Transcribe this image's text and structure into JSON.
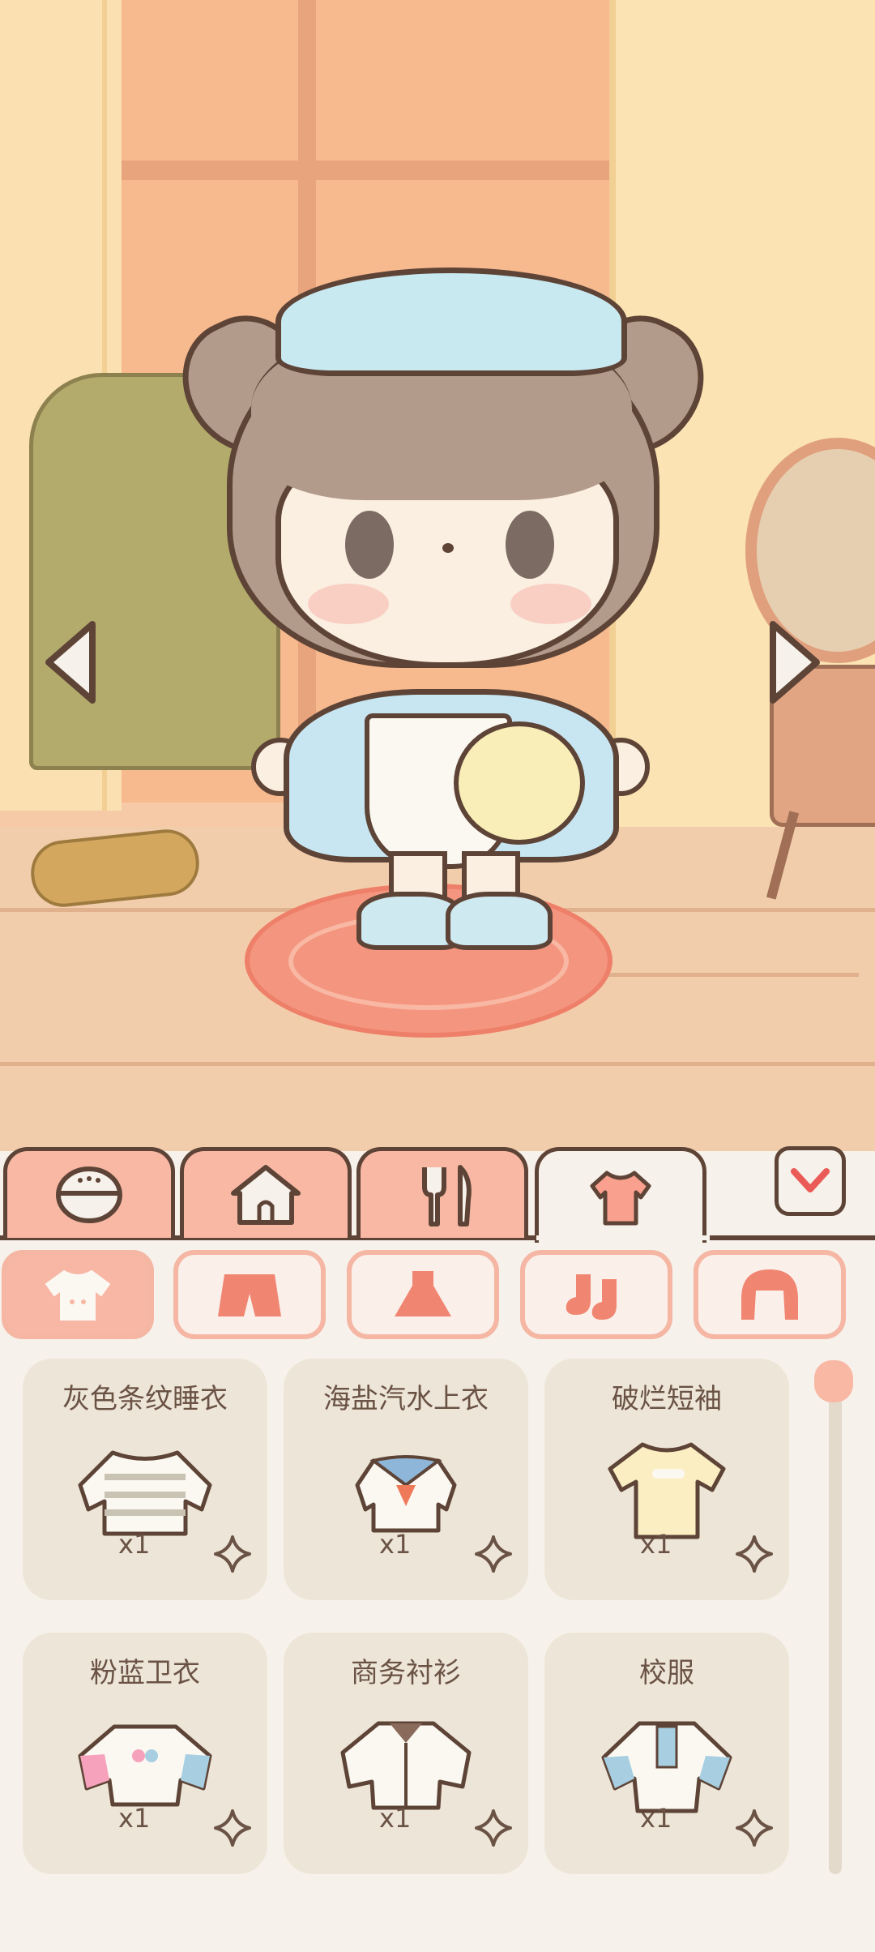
{
  "scene": {
    "character": "girl with pigtails, blue beret, blue dress, white apron, crossbody bag"
  },
  "nav": {
    "left_icon": "triangle-left-icon",
    "right_icon": "triangle-right-icon"
  },
  "tabs": [
    {
      "icon": "burger-icon",
      "active": false
    },
    {
      "icon": "house-icon",
      "active": false
    },
    {
      "icon": "fork-knife-icon",
      "active": false
    },
    {
      "icon": "shirt-icon",
      "active": true
    }
  ],
  "collapse": {
    "icon": "chevron-down-icon"
  },
  "categories": [
    {
      "icon": "top-icon",
      "active": true
    },
    {
      "icon": "shorts-icon",
      "active": false
    },
    {
      "icon": "dress-icon",
      "active": false
    },
    {
      "icon": "socks-icon",
      "active": false
    },
    {
      "icon": "hair-icon",
      "active": false
    }
  ],
  "items": [
    {
      "name": "灰色条纹睡衣",
      "count": "x1",
      "icon": "striped-sweater-icon"
    },
    {
      "name": "海盐汽水上衣",
      "count": "x1",
      "icon": "sailor-top-icon"
    },
    {
      "name": "破烂短袖",
      "count": "x1",
      "icon": "tshirt-icon"
    },
    {
      "name": "粉蓝卫衣",
      "count": "x1",
      "icon": "hoodie-icon"
    },
    {
      "name": "商务衬衫",
      "count": "x1",
      "icon": "shirt-icon"
    },
    {
      "name": "校服",
      "count": "x1",
      "icon": "uniform-icon"
    }
  ],
  "colors": {
    "accent": "#f9b8a4",
    "outline": "#5e4437",
    "panel": "#f6f1ea",
    "card": "#ede6d8"
  }
}
